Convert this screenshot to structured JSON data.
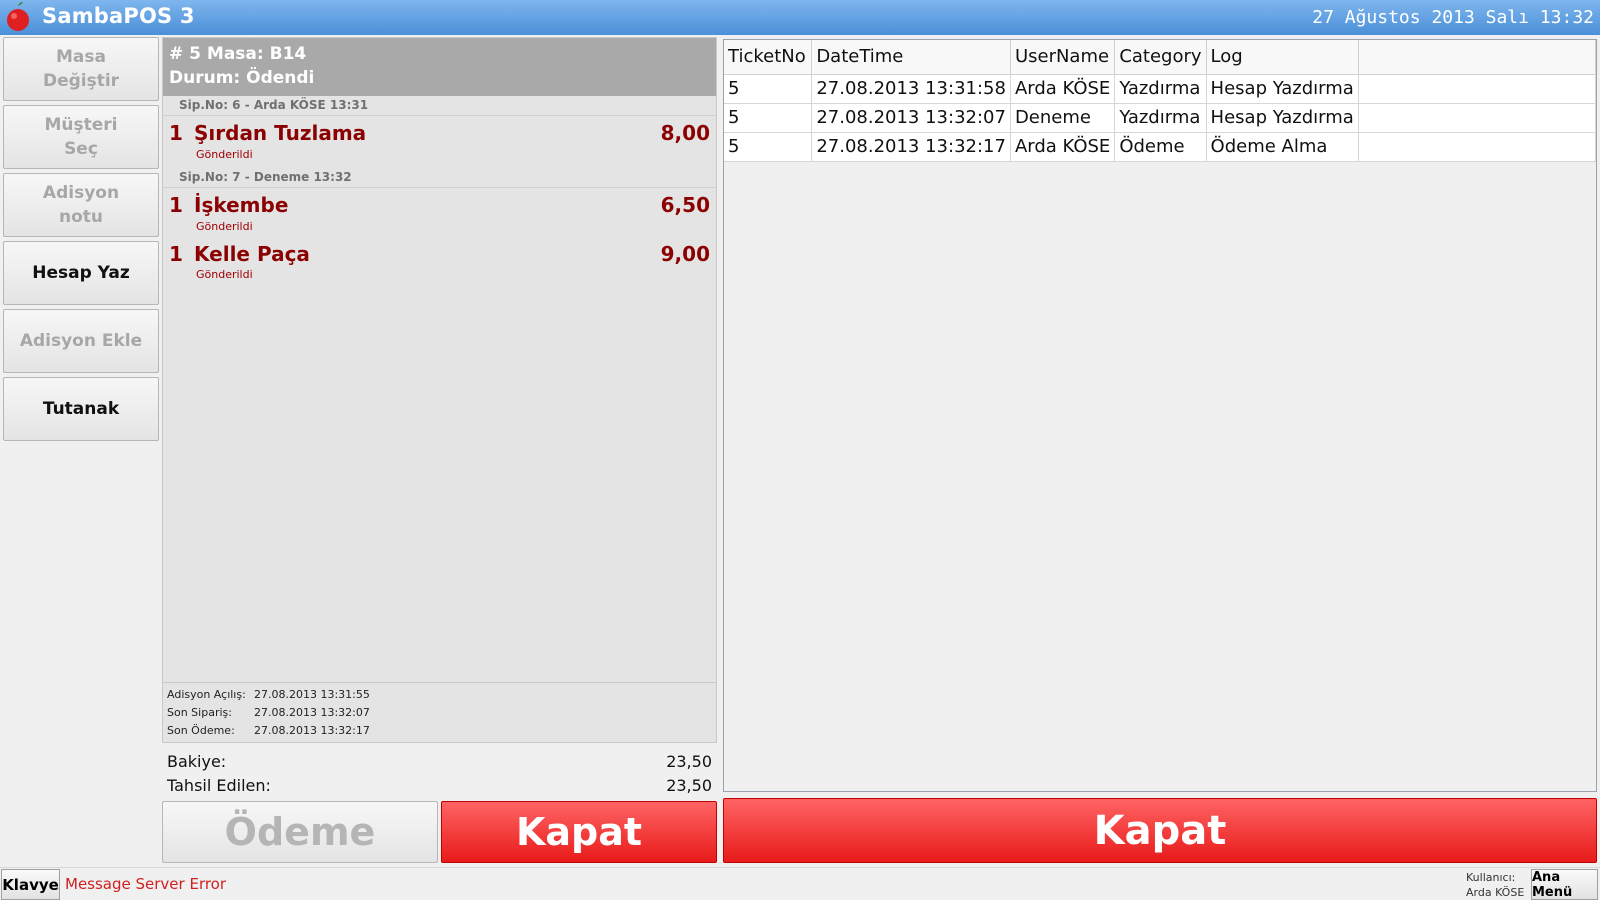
{
  "app": {
    "title": "SambaPOS 3",
    "clock": "27 Ağustos 2013 Salı 13:32"
  },
  "side_buttons": [
    {
      "label_line1": "Masa",
      "label_line2": "Değiştir",
      "enabled": false
    },
    {
      "label_line1": "Müşteri",
      "label_line2": "Seç",
      "enabled": false
    },
    {
      "label_line1": "Adisyon",
      "label_line2": "notu",
      "enabled": false
    },
    {
      "label_line1": "Hesap Yaz",
      "label_line2": "",
      "enabled": true
    },
    {
      "label_line1": "Adisyon Ekle",
      "label_line2": "",
      "enabled": false
    },
    {
      "label_line1": "Tutanak",
      "label_line2": "",
      "enabled": true
    }
  ],
  "ticket": {
    "header_line1": "# 5 Masa: B14",
    "header_line2": "Durum: Ödendi",
    "groups": [
      {
        "caption": "Sip.No: 6 - Arda KÖSE 13:31"
      },
      {
        "caption": "Sip.No: 7 - Deneme 13:32"
      }
    ],
    "orders": [
      {
        "qty": "1",
        "name": "Şırdan Tuzlama",
        "price": "8,00",
        "status": "Gönderildi"
      },
      {
        "qty": "1",
        "name": "İşkembe",
        "price": "6,50",
        "status": "Gönderildi"
      },
      {
        "qty": "1",
        "name": "Kelle Paça",
        "price": "9,00",
        "status": "Gönderildi"
      }
    ],
    "info": [
      {
        "label": "Adisyon Açılış:",
        "value": "27.08.2013 13:31:55"
      },
      {
        "label": "Son Sipariş:",
        "value": "27.08.2013 13:32:07"
      },
      {
        "label": "Son Ödeme:",
        "value": "27.08.2013 13:32:17"
      }
    ],
    "totals": [
      {
        "label": "Bakiye:",
        "value": "23,50"
      },
      {
        "label": "Tahsil Edilen:",
        "value": "23,50"
      }
    ]
  },
  "actions": {
    "payment_label": "Ödeme",
    "close_label": "Kapat",
    "close_large_label": "Kapat"
  },
  "log": {
    "columns": [
      "TicketNo",
      "DateTime",
      "UserName",
      "Category",
      "Log"
    ],
    "rows": [
      [
        "5",
        "27.08.2013 13:31:58",
        "Arda KÖSE",
        "Yazdırma",
        "Hesap Yazdırma"
      ],
      [
        "5",
        "27.08.2013 13:32:07",
        "Deneme",
        "Yazdırma",
        "Hesap Yazdırma"
      ],
      [
        "5",
        "27.08.2013 13:32:17",
        "Arda KÖSE",
        "Ödeme",
        "Ödeme Alma"
      ]
    ]
  },
  "statusbar": {
    "keyboard_label": "Klavye",
    "message": "Message Server Error",
    "user_caption": "Kullanıcı:",
    "user_name": "Arda KÖSE",
    "main_menu_label": "Ana Menü"
  },
  "colors": {
    "title_bar": "#5a9be0",
    "order_text": "#8b0000",
    "action_red": "#f03030",
    "error_text": "#d02020"
  }
}
